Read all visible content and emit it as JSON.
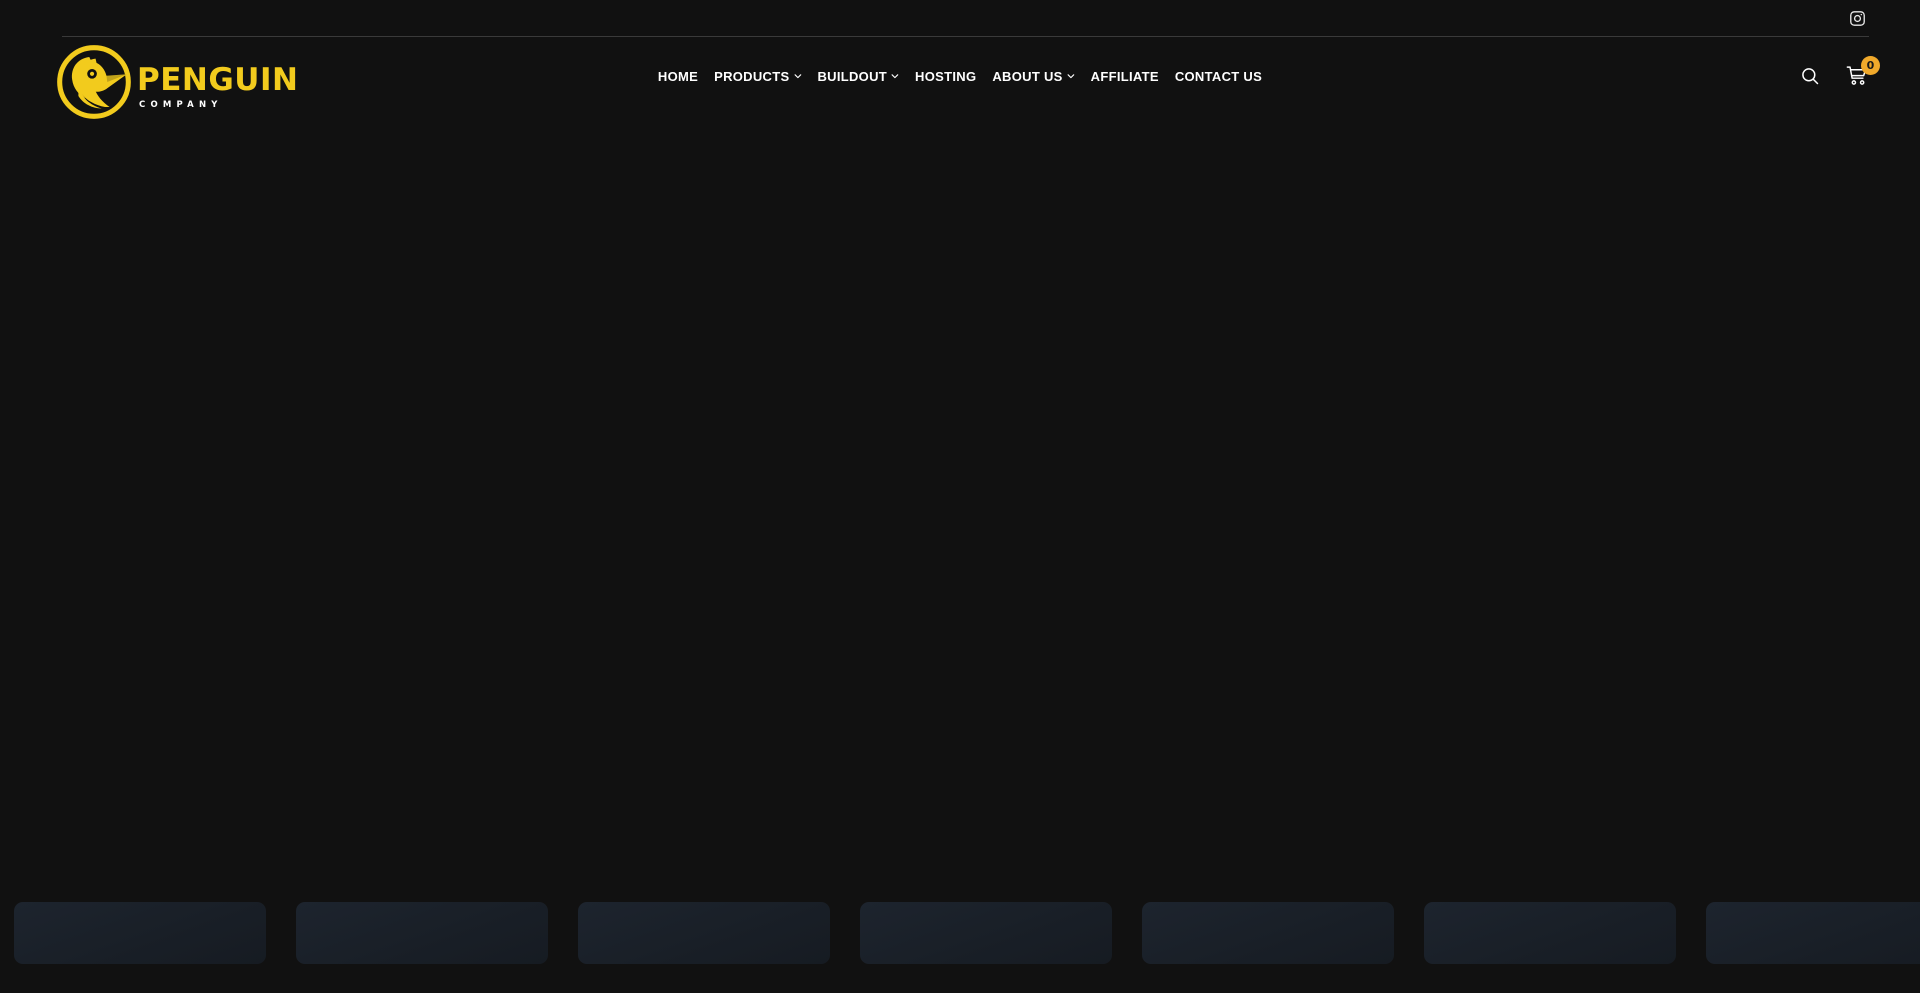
{
  "site": {
    "background_color": "#111111",
    "accent_color": "#F2CB1D",
    "badge_color": "#F0A92B"
  },
  "topbar": {
    "social": [
      {
        "name": "instagram-icon",
        "label": "Instagram"
      }
    ]
  },
  "logo": {
    "mark": "penguin-logo-icon",
    "primary": "PENGUIN",
    "secondary": "COMPANY"
  },
  "nav": {
    "items": [
      {
        "label": "HOME",
        "has_dropdown": false
      },
      {
        "label": "PRODUCTS",
        "has_dropdown": true
      },
      {
        "label": "BUILDOUT",
        "has_dropdown": true
      },
      {
        "label": "HOSTING",
        "has_dropdown": false
      },
      {
        "label": "ABOUT US",
        "has_dropdown": true
      },
      {
        "label": "AFFILIATE",
        "has_dropdown": false
      },
      {
        "label": "CONTACT US",
        "has_dropdown": false
      }
    ]
  },
  "actions": {
    "search": {
      "icon": "search-icon",
      "label": "Search"
    },
    "cart": {
      "icon": "cart-icon",
      "label": "Cart",
      "count": "0"
    }
  },
  "cards": {
    "count": 7,
    "placeholder_color": "#1a2029"
  }
}
